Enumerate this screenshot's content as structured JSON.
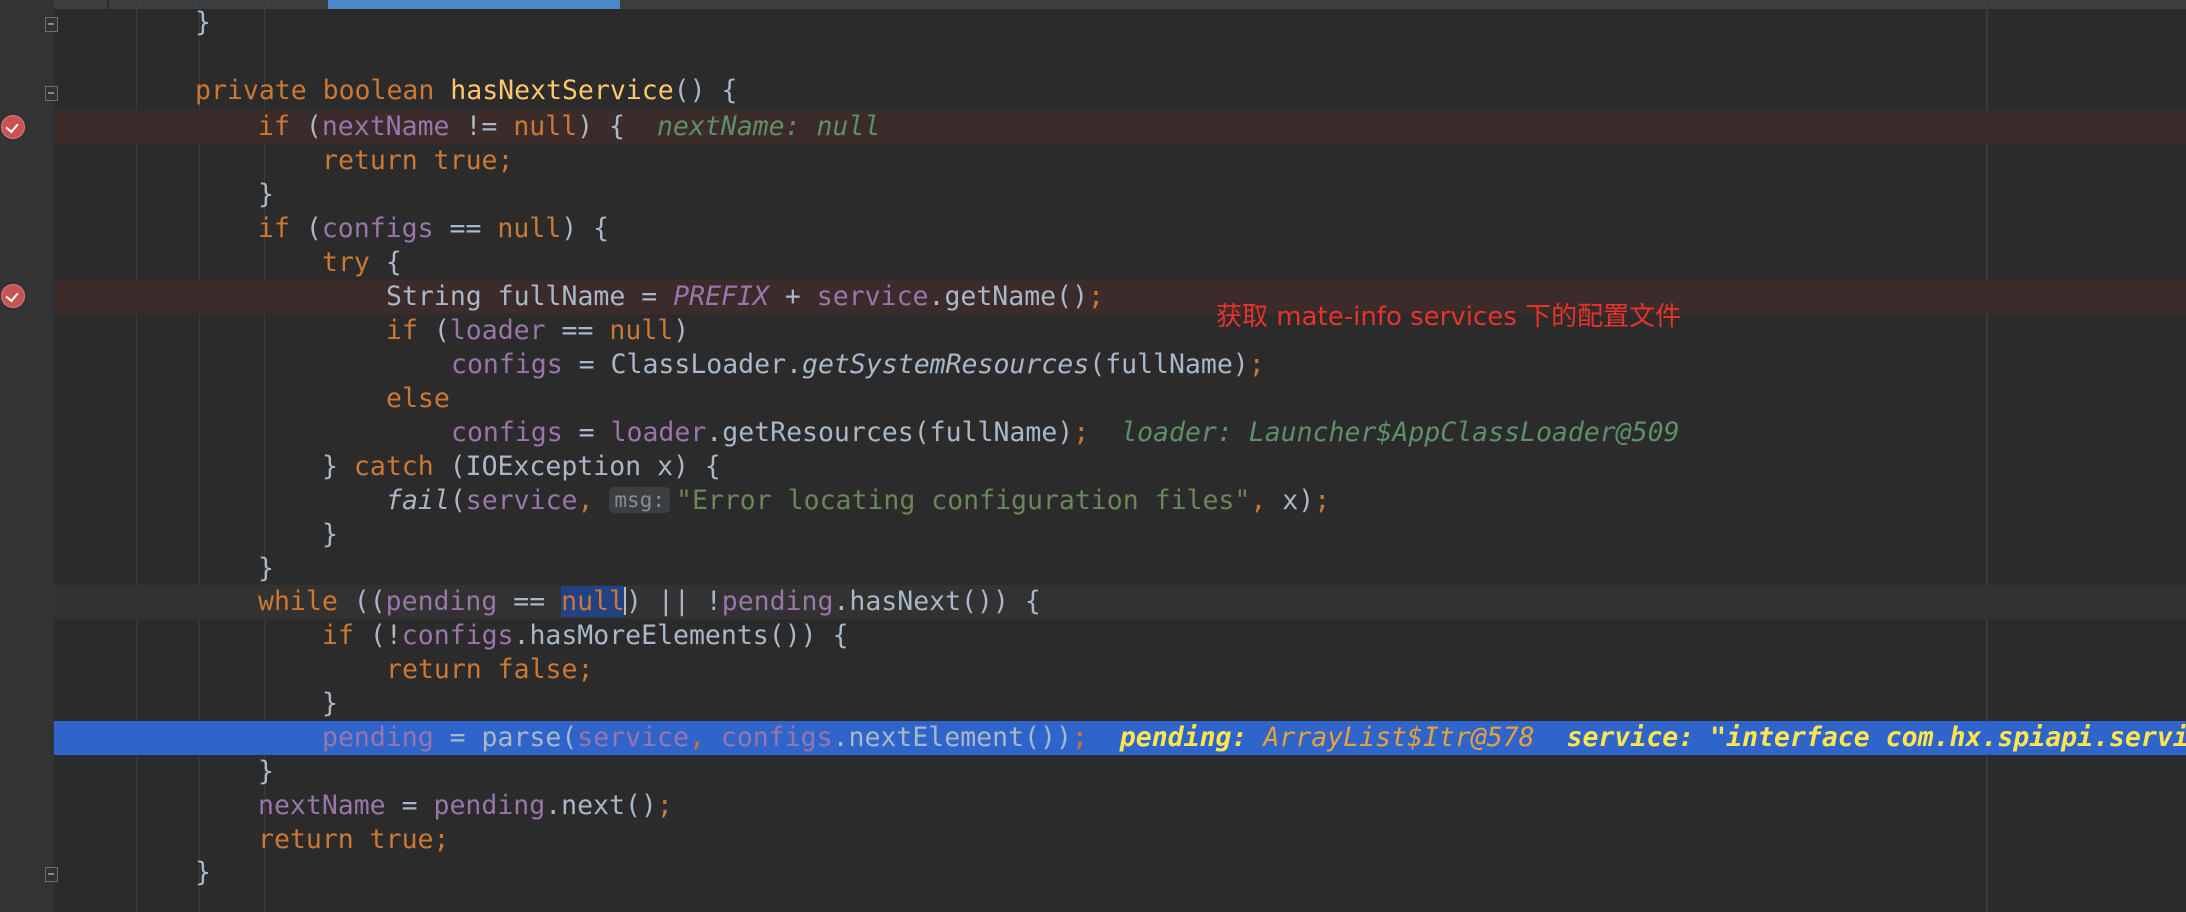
{
  "lines": {
    "l0": "}",
    "l2": {
      "kw": "private boolean ",
      "fn": "hasNextService",
      "rest": "() {"
    },
    "l3": {
      "kw1": "if",
      "p1": " (",
      "fld": "nextName",
      "p2": " != ",
      "kw2": "null",
      "p3": ") {",
      "hint": "nextName: null"
    },
    "l4": {
      "kw": "return true",
      "semi": ";"
    },
    "l5": "}",
    "l6": {
      "kw1": "if",
      "p1": " (",
      "fld": "configs",
      "p2": " == ",
      "kw2": "null",
      "p3": ") {"
    },
    "l7": {
      "kw": "try",
      "rest": " {"
    },
    "l8": {
      "p1": "String fullName = ",
      "static": "PREFIX",
      "p2": " + ",
      "fld": "service",
      "p3": ".getName()",
      "semi": ";"
    },
    "l9": {
      "kw1": "if",
      "p1": " (",
      "fld": "loader",
      "p2": " == ",
      "kw2": "null",
      "p3": ")"
    },
    "l10": {
      "fld": "configs",
      "p1": " = ClassLoader.",
      "it": "getSystemResources",
      "p2": "(fullName)",
      "semi": ";"
    },
    "l11": {
      "kw": "else"
    },
    "l12": {
      "fld1": "configs",
      "p1": " = ",
      "fld2": "loader",
      "p2": ".getResources(fullName)",
      "semi": ";",
      "hint": "loader: Launcher$AppClassLoader@509"
    },
    "l13": {
      "p1": "} ",
      "kw": "catch",
      "p2": " (IOException x) {"
    },
    "l14": {
      "it": "fail",
      "p1": "(",
      "fld": "service",
      "comma": ", ",
      "param": "msg:",
      "str": "\"Error locating configuration files\"",
      "comma2": ", ",
      "p2": "x)",
      "semi": ";"
    },
    "l15": "}",
    "l16": "}",
    "l17": {
      "kw": "while",
      "p1": " ((",
      "fld1": "pending",
      "p2": " == ",
      "sel": "null",
      "p3": ") || !",
      "fld2": "pending",
      "p4": ".hasNext()) {"
    },
    "l18": {
      "kw": "if",
      "p1": " (!",
      "fld": "configs",
      "p2": ".hasMoreElements()) {"
    },
    "l19": {
      "kw": "return false",
      "semi": ";"
    },
    "l20": "}",
    "l21": {
      "fld1": "pending",
      "p1": " = parse(",
      "fld2": "service",
      "comma": ", ",
      "fld3": "configs",
      "p2": ".nextElement())",
      "semi": ";",
      "v1_name": "pending:",
      "v1_val": "ArrayList$Itr@578",
      "v2_name": "service:",
      "v2_val": "\"interface com.hx.spiapi.servi"
    },
    "l22": "}",
    "l23": {
      "fld1": "nextName",
      "p1": " = ",
      "fld2": "pending",
      "p2": ".next()",
      "semi": ";"
    },
    "l24": {
      "kw": "return true",
      "semi": ";"
    },
    "l25": "}"
  },
  "annotation": "获取 mate-info services 下的配置文件"
}
